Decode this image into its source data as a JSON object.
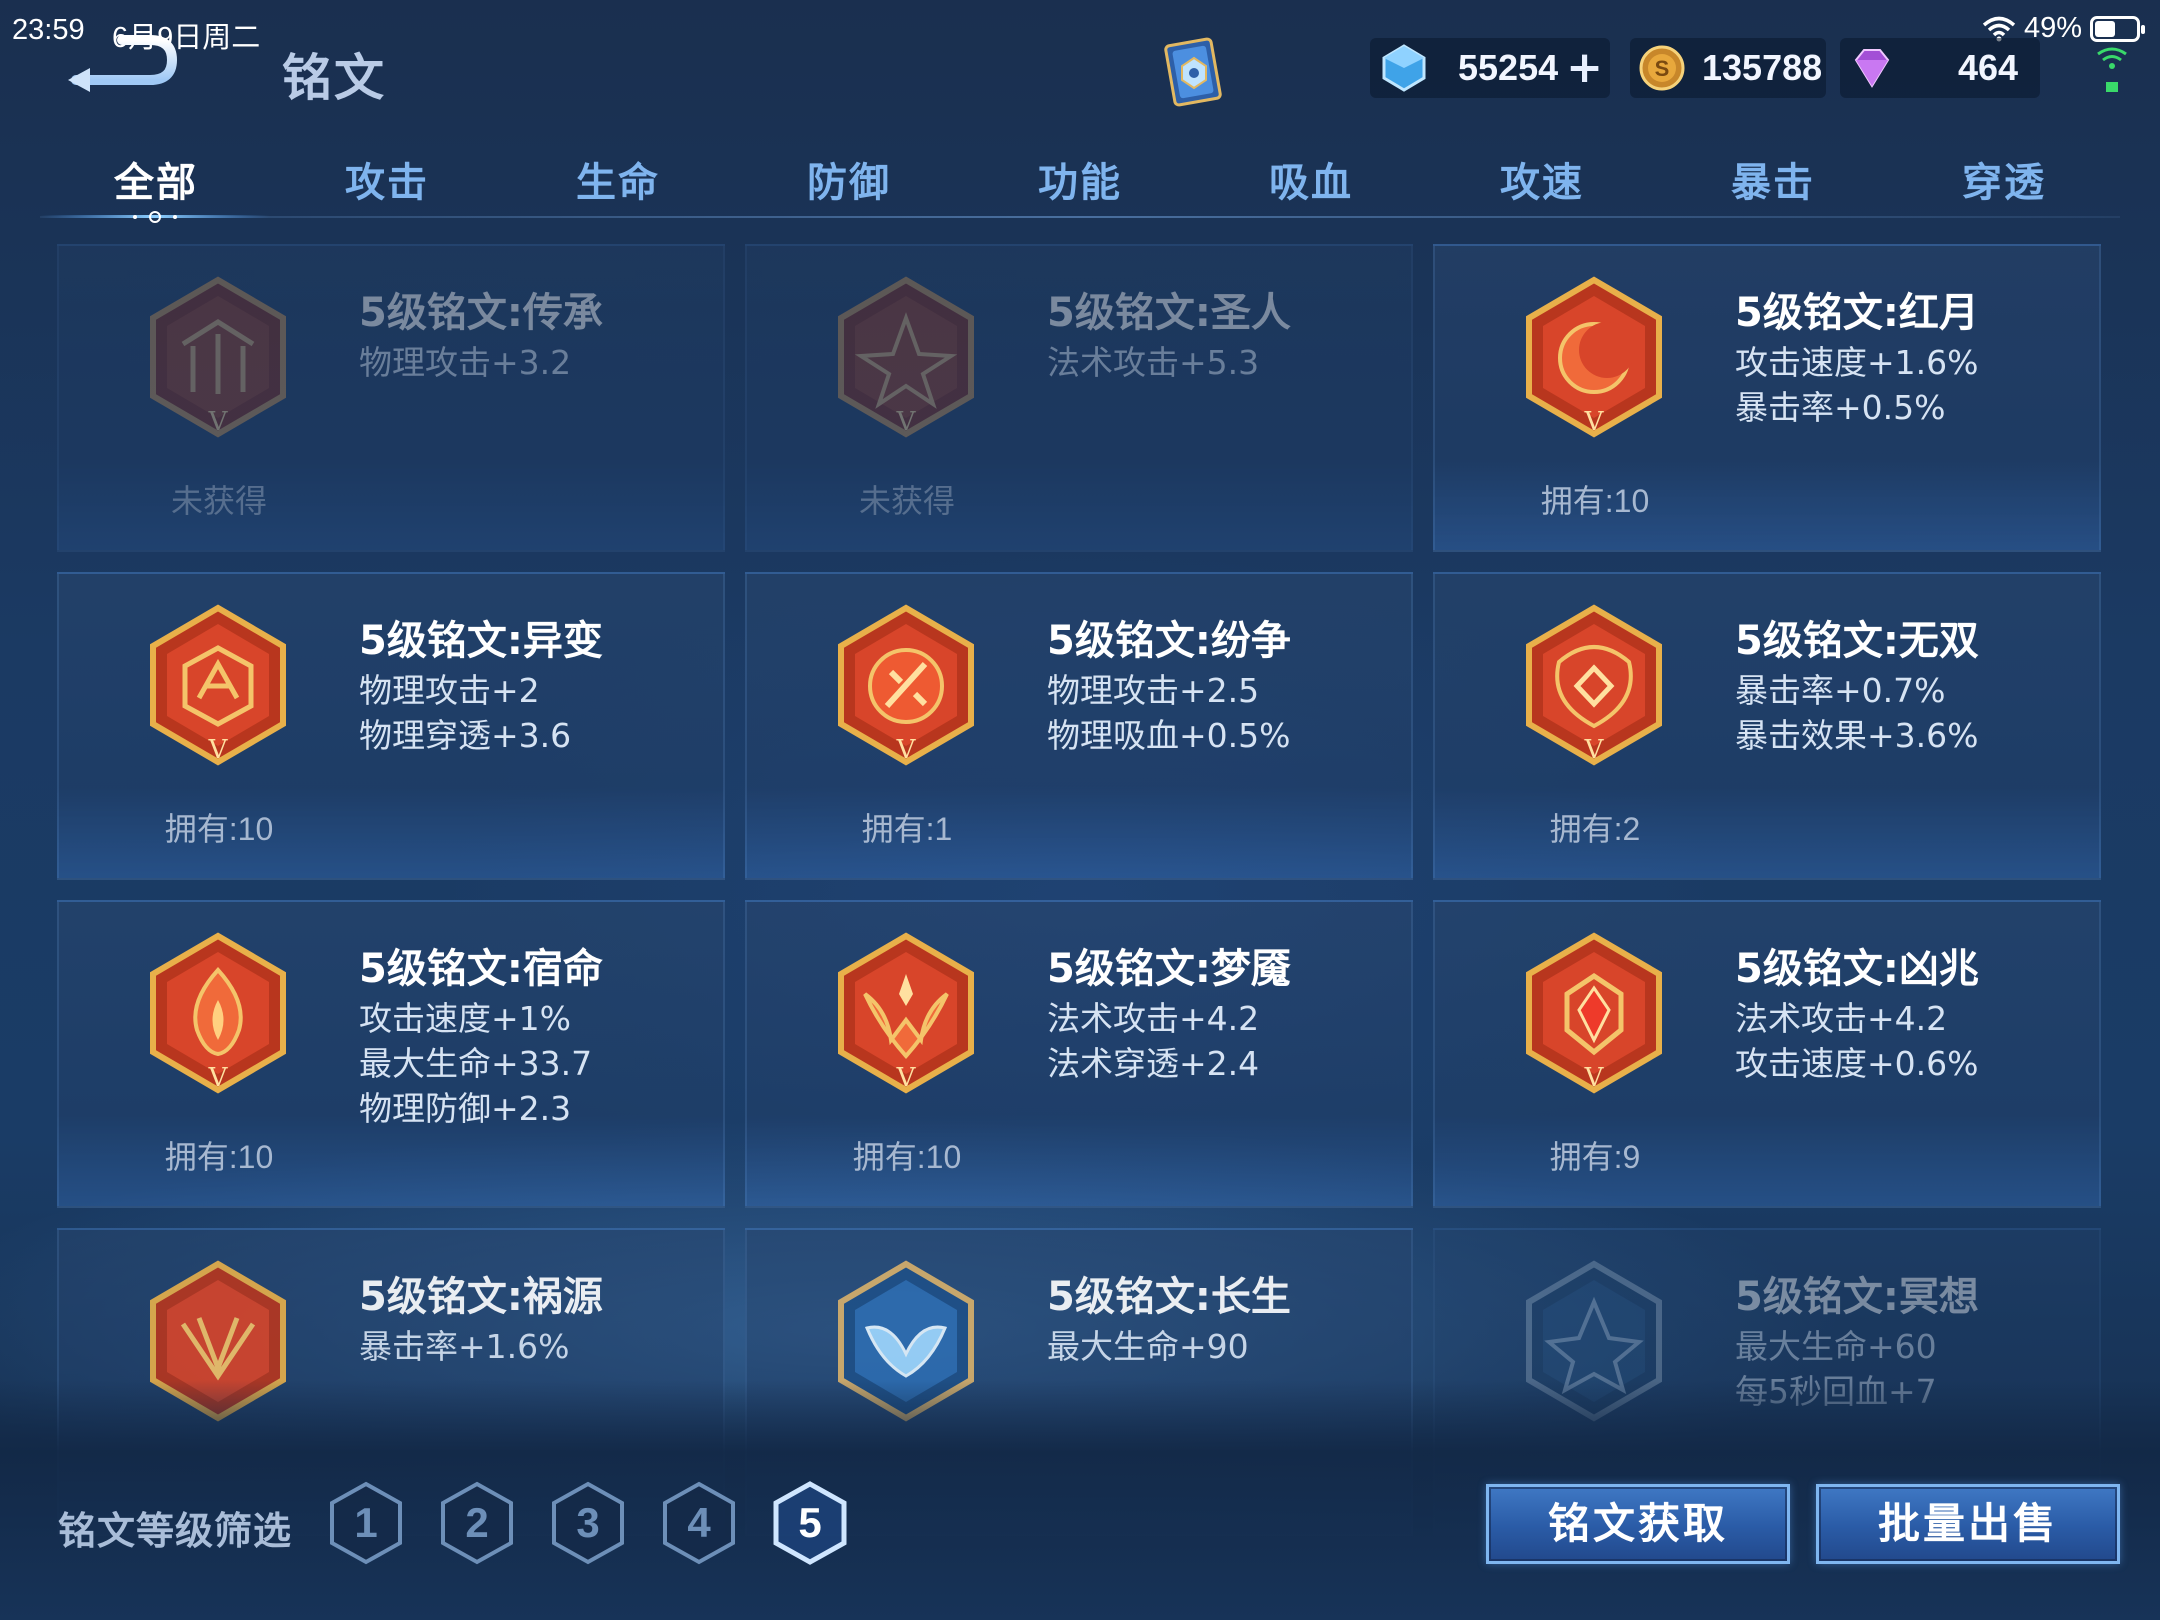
{
  "status": {
    "time": "23:59",
    "date": "6月9日周二",
    "battery": "49%"
  },
  "header": {
    "title": "铭文",
    "currencies": {
      "gems": "55254",
      "coins": "135788",
      "diamonds": "464"
    }
  },
  "tabs": [
    "全部",
    "攻击",
    "生命",
    "防御",
    "功能",
    "吸血",
    "攻速",
    "暴击",
    "穿透"
  ],
  "active_tab": "全部",
  "runes": [
    {
      "name": "5级铭文:传承",
      "stats": [
        "物理攻击+3.2"
      ],
      "owned": "未获得",
      "locked": true,
      "theme": "red"
    },
    {
      "name": "5级铭文:圣人",
      "stats": [
        "法术攻击+5.3"
      ],
      "owned": "未获得",
      "locked": true,
      "theme": "red"
    },
    {
      "name": "5级铭文:红月",
      "stats": [
        "攻击速度+1.6%",
        "暴击率+0.5%"
      ],
      "owned": "拥有:10",
      "locked": false,
      "theme": "red"
    },
    {
      "name": "5级铭文:异变",
      "stats": [
        "物理攻击+2",
        "物理穿透+3.6"
      ],
      "owned": "拥有:10",
      "locked": false,
      "theme": "red"
    },
    {
      "name": "5级铭文:纷争",
      "stats": [
        "物理攻击+2.5",
        "物理吸血+0.5%"
      ],
      "owned": "拥有:1",
      "locked": false,
      "theme": "red"
    },
    {
      "name": "5级铭文:无双",
      "stats": [
        "暴击率+0.7%",
        "暴击效果+3.6%"
      ],
      "owned": "拥有:2",
      "locked": false,
      "theme": "red"
    },
    {
      "name": "5级铭文:宿命",
      "stats": [
        "攻击速度+1%",
        "最大生命+33.7",
        "物理防御+2.3"
      ],
      "owned": "拥有:10",
      "locked": false,
      "theme": "red"
    },
    {
      "name": "5级铭文:梦魇",
      "stats": [
        "法术攻击+4.2",
        "法术穿透+2.4"
      ],
      "owned": "拥有:10",
      "locked": false,
      "theme": "red"
    },
    {
      "name": "5级铭文:凶兆",
      "stats": [
        "法术攻击+4.2",
        "攻击速度+0.6%"
      ],
      "owned": "拥有:9",
      "locked": false,
      "theme": "red"
    },
    {
      "name": "5级铭文:祸源",
      "stats": [
        "暴击率+1.6%"
      ],
      "owned": "",
      "locked": false,
      "theme": "red"
    },
    {
      "name": "5级铭文:长生",
      "stats": [
        "最大生命+90"
      ],
      "owned": "",
      "locked": false,
      "theme": "blue"
    },
    {
      "name": "5级铭文:冥想",
      "stats": [
        "最大生命+60",
        "每5秒回血+7"
      ],
      "owned": "",
      "locked": true,
      "theme": "blue"
    }
  ],
  "filter": {
    "label": "铭文等级筛选",
    "levels": [
      "1",
      "2",
      "3",
      "4",
      "5"
    ],
    "active": "5"
  },
  "buttons": {
    "acquire": "铭文获取",
    "bulk_sell": "批量出售"
  },
  "colors": {
    "accent": "#7fb4ee",
    "emblem_red": "#d8452a",
    "emblem_gold": "#e8b04a",
    "button_blue": "#2a5ba6"
  }
}
